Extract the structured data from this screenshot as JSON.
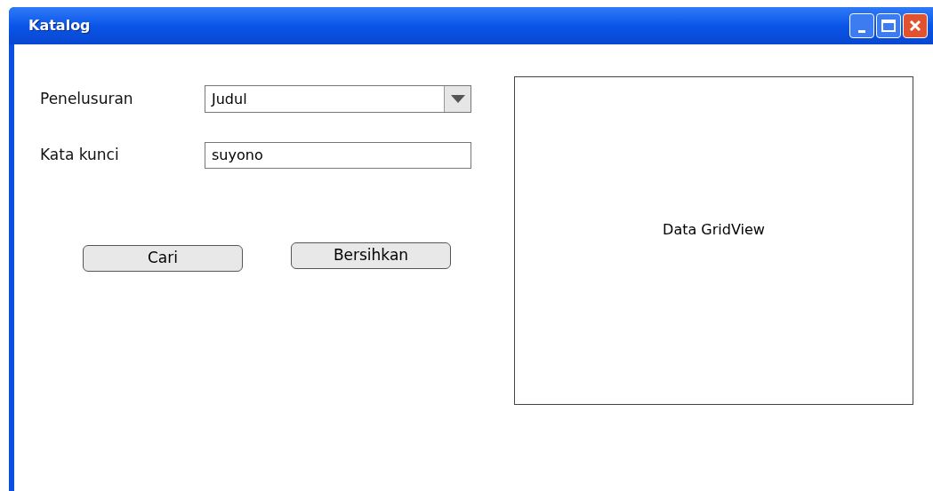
{
  "window": {
    "title": "Katalog"
  },
  "form": {
    "fields": [
      {
        "label": "Penelusuran",
        "kind": "select",
        "value": "Judul"
      },
      {
        "label": "Kata kunci",
        "kind": "text",
        "value": "suyono"
      }
    ]
  },
  "buttons": [
    "Cari",
    "Bersihkan"
  ],
  "grid_view": {
    "text": "Data GridView"
  }
}
